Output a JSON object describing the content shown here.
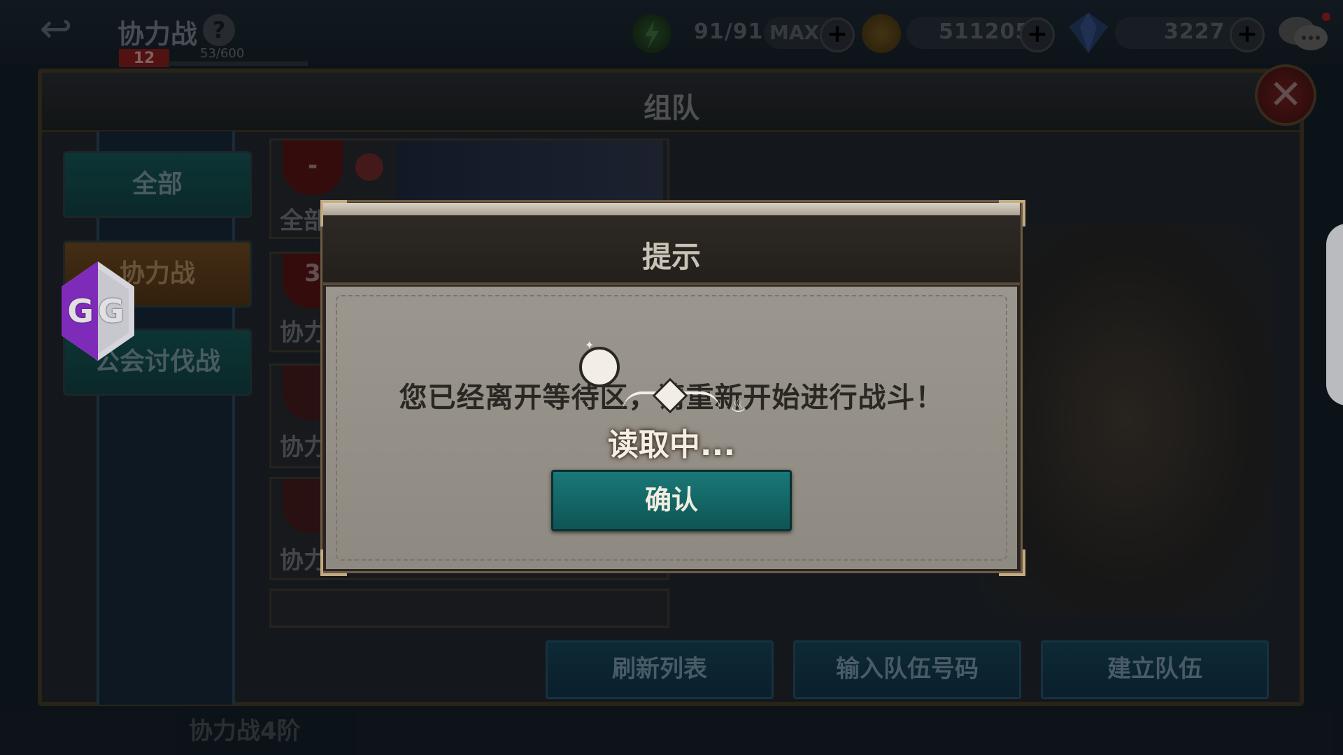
{
  "topbar": {
    "mode_title": "协力战",
    "help_symbol": "?",
    "level": "12",
    "exp": "53/600",
    "stamina": "91/91",
    "stamina_max_tag": "MAX",
    "gold": "511205",
    "gems": "3227",
    "plus_symbol": "+",
    "back_symbol": "↩"
  },
  "panel": {
    "title": "组队",
    "close_symbol": "✕"
  },
  "tabs": [
    {
      "label": "全部"
    },
    {
      "label": "协力战"
    },
    {
      "label": "公会讨伐战"
    }
  ],
  "list": [
    {
      "label": "全部",
      "badge": "-"
    },
    {
      "label": "协力",
      "badge": "3"
    },
    {
      "label": "协力",
      "badge": ""
    },
    {
      "label": "协力",
      "badge": ""
    }
  ],
  "bottom_buttons": {
    "refresh": "刷新列表",
    "enter_code": "输入队伍号码",
    "create": "建立队伍"
  },
  "footer_ghost": "协力战4阶",
  "dialog": {
    "title": "提示",
    "message": "您已经离开等待区，请重新开始进行战斗！",
    "loading": "读取中...",
    "confirm": "确认"
  },
  "overlay_app": {
    "label": "GG"
  },
  "colors": {
    "teal_button": "#1a7878",
    "dialog_body": "#9b968e",
    "gg_purple": "#8a2fc9"
  }
}
